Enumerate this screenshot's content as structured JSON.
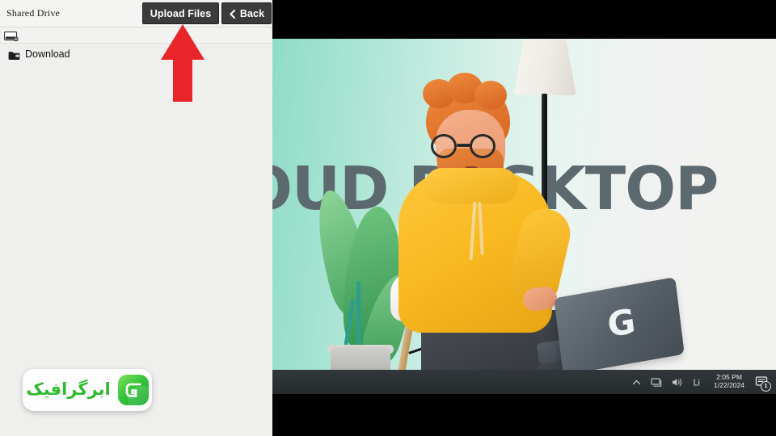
{
  "file_panel": {
    "title": "Shared Drive",
    "buttons": {
      "upload": "Upload Files",
      "back": "Back"
    },
    "drive_row": {
      "icon": "drive-icon",
      "label": ""
    },
    "items": [
      {
        "icon": "folder-icon",
        "label": "Download"
      }
    ]
  },
  "annotation": {
    "arrow": "red-up-arrow",
    "color": "#e8252a",
    "points_at": "Upload Files"
  },
  "watermark": {
    "text": "ابرگرافیک",
    "logo_letter": "G",
    "brand_color": "#2fba2f"
  },
  "video": {
    "headline": "OUD DESKTOP",
    "headline_color": "#5c6a70",
    "laptop_logo": "G",
    "scene_objects": [
      "floor-lamp",
      "potted-plant",
      "eames-chair",
      "character-with-laptop"
    ],
    "taskbar": {
      "tray_icons": [
        "chevron-up-icon",
        "network-icon",
        "volume-icon",
        "keyboard-layout-icon"
      ],
      "time": "2:05 PM",
      "date": "1/22/2024",
      "notification_count": "1"
    }
  }
}
